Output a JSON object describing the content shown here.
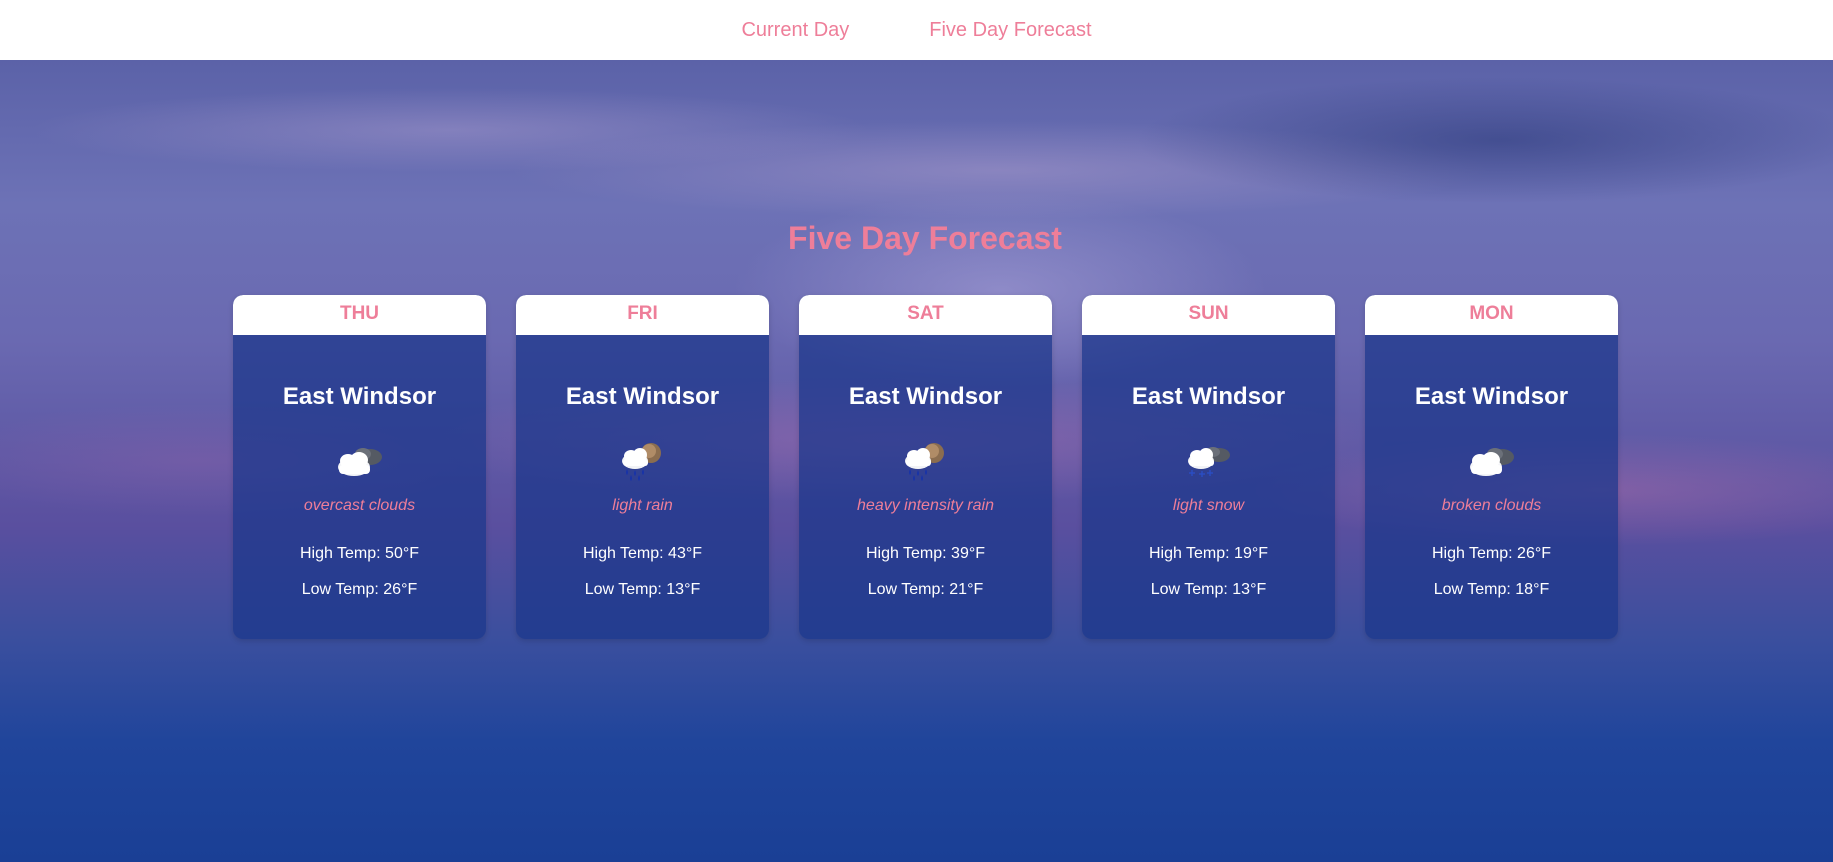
{
  "nav": {
    "current_day": "Current Day",
    "five_day": "Five Day Forecast"
  },
  "page": {
    "title": "Five Day Forecast"
  },
  "days": [
    {
      "day": "THU",
      "city": "East Windsor",
      "icon": "overcast-clouds-icon",
      "desc": "overcast clouds",
      "high": "High Temp: 50°F",
      "low": "Low Temp: 26°F"
    },
    {
      "day": "FRI",
      "city": "East Windsor",
      "icon": "light-rain-icon",
      "desc": "light rain",
      "high": "High Temp: 43°F",
      "low": "Low Temp: 13°F"
    },
    {
      "day": "SAT",
      "city": "East Windsor",
      "icon": "heavy-rain-icon",
      "desc": "heavy intensity rain",
      "high": "High Temp: 39°F",
      "low": "Low Temp: 21°F"
    },
    {
      "day": "SUN",
      "city": "East Windsor",
      "icon": "light-snow-icon",
      "desc": "light snow",
      "high": "High Temp: 19°F",
      "low": "Low Temp: 13°F"
    },
    {
      "day": "MON",
      "city": "East Windsor",
      "icon": "broken-clouds-icon",
      "desc": "broken clouds",
      "high": "High Temp: 26°F",
      "low": "Low Temp: 18°F"
    }
  ],
  "colors": {
    "accent": "#ee7e99",
    "card_bg": "#1a368a",
    "header_bg": "#ffffff"
  }
}
